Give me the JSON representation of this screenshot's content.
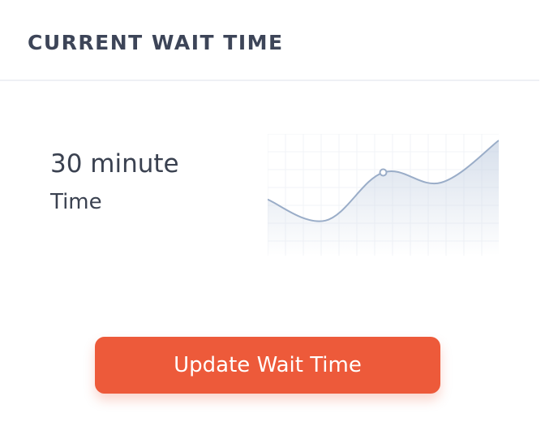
{
  "card": {
    "title": "CURRENT WAIT TIME",
    "value": "30 minute",
    "label": "Time",
    "button_label": "Update Wait Time"
  },
  "colors": {
    "accent": "#ed5a3a",
    "text": "#3a4150",
    "line": "#9aadc8",
    "divider": "#eef0f5"
  },
  "sparkline": {
    "values": [
      0.3,
      0.05,
      0.62,
      0.5,
      1.0
    ],
    "highlight_index": 2
  }
}
